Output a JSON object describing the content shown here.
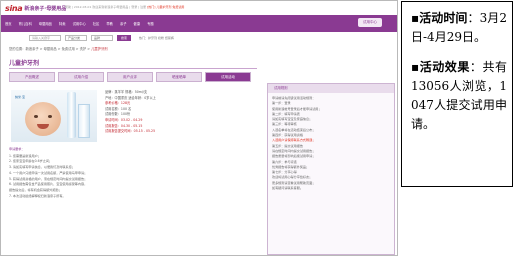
{
  "site": {
    "logo_sina": "sina",
    "logo_text": "新浪亲子·母婴用品",
    "top_links": "帮助 | 2012-03-01 欢迎来到新浪亲子母婴用品 | 登录 | 注册",
    "top_hot": "[热门] 儿童护牙剂 免费试用"
  },
  "nav": {
    "items": [
      "首页",
      "育儿百科",
      "母婴用品",
      "特卖",
      "试用中心",
      "社区",
      "早教",
      "亲子",
      "健康",
      "专题"
    ],
    "trial_label": "试用中心"
  },
  "search": {
    "placeholder": "请输入关键字",
    "category": "产品分类",
    "brand": "品牌",
    "button": "搜索",
    "tags": "热门：护牙剂 奶粉 纸尿裤"
  },
  "breadcrumb": {
    "path": "您的位置：新浪亲子 > 母婴用品 > 免费试用 > 洗护 >",
    "current": "儿童护牙剂"
  },
  "product": {
    "title": "儿童护牙剂",
    "tabs": [
      "产品概述",
      "试用介绍",
      "用户点评",
      "晒宝晒单",
      "试用活动"
    ],
    "brand_mark": "纳米·宝",
    "spec_lines": [
      "品牌：蒸羊羊    规格：50ml/支",
      "产地：中国重庆    适合年龄：0岁以上",
      "参考价格：128元",
      "试用名额：100 名",
      "试用份数：100份",
      "申请时间：03.02 - 04.29",
      "试用报告：04.30 - 05.15",
      "试用报告提交时间：05.15 - 05.25"
    ],
    "desc_title": "申请要求：",
    "desc_lines": [
      "1. 您需要是新浪用户；",
      "2. 您家宝宝年龄在0-6岁之间；",
      "3. 请如实填写申请信息，以便我们及时联系您；",
      "4. 一个用户只能申请一次试用名额，严禁使用马甲申请；",
      "5. 获得试用资格的用户，须在规定时间内提交试用报告；",
      "6. 试用报告需包含产品使用照片、宝宝使用感受等内容，",
      "   报告提交后，将有机会获得额外奖励；",
      "7. 本次活动最终解释权归新浪亲子所有。"
    ]
  },
  "sidebar": {
    "title": "试用规则",
    "lines": [
      "申请前请先阅读试用活动规则：",
      "第一步：登录",
      "使用新浪帐号登录后才能申请试用；",
      "第二步：填写申请表",
      "请如实填写宝宝及家庭信息；",
      "第三步：等待审核",
      "入选名单将在活动结束后公布；",
      "第四步：获得试用资格",
      "入选用户请保持联系方式畅通；",
      "第五步：提交试用报告",
      "请在规定时间内提交试用报告；",
      "报告质量将影响后续试用申请；",
      "第六步：参与评选",
      "优秀报告将获得额外奖品；",
      "第七步：分享心得",
      "欢迎将试用心得分享给好友；",
      "更多规则请查看试用帮助页面；",
      "如有疑问请联系客服。"
    ]
  },
  "note": {
    "bullet": "▪",
    "time_label": "活动时间",
    "time_value": "：3月2日-4月29日。",
    "effect_label": "活动效果",
    "effect_value": "：共有13056人浏览，1047人提交试用申请。"
  },
  "colors": {
    "brand_purple": "#8a3a92",
    "accent_red": "#c0232c"
  }
}
